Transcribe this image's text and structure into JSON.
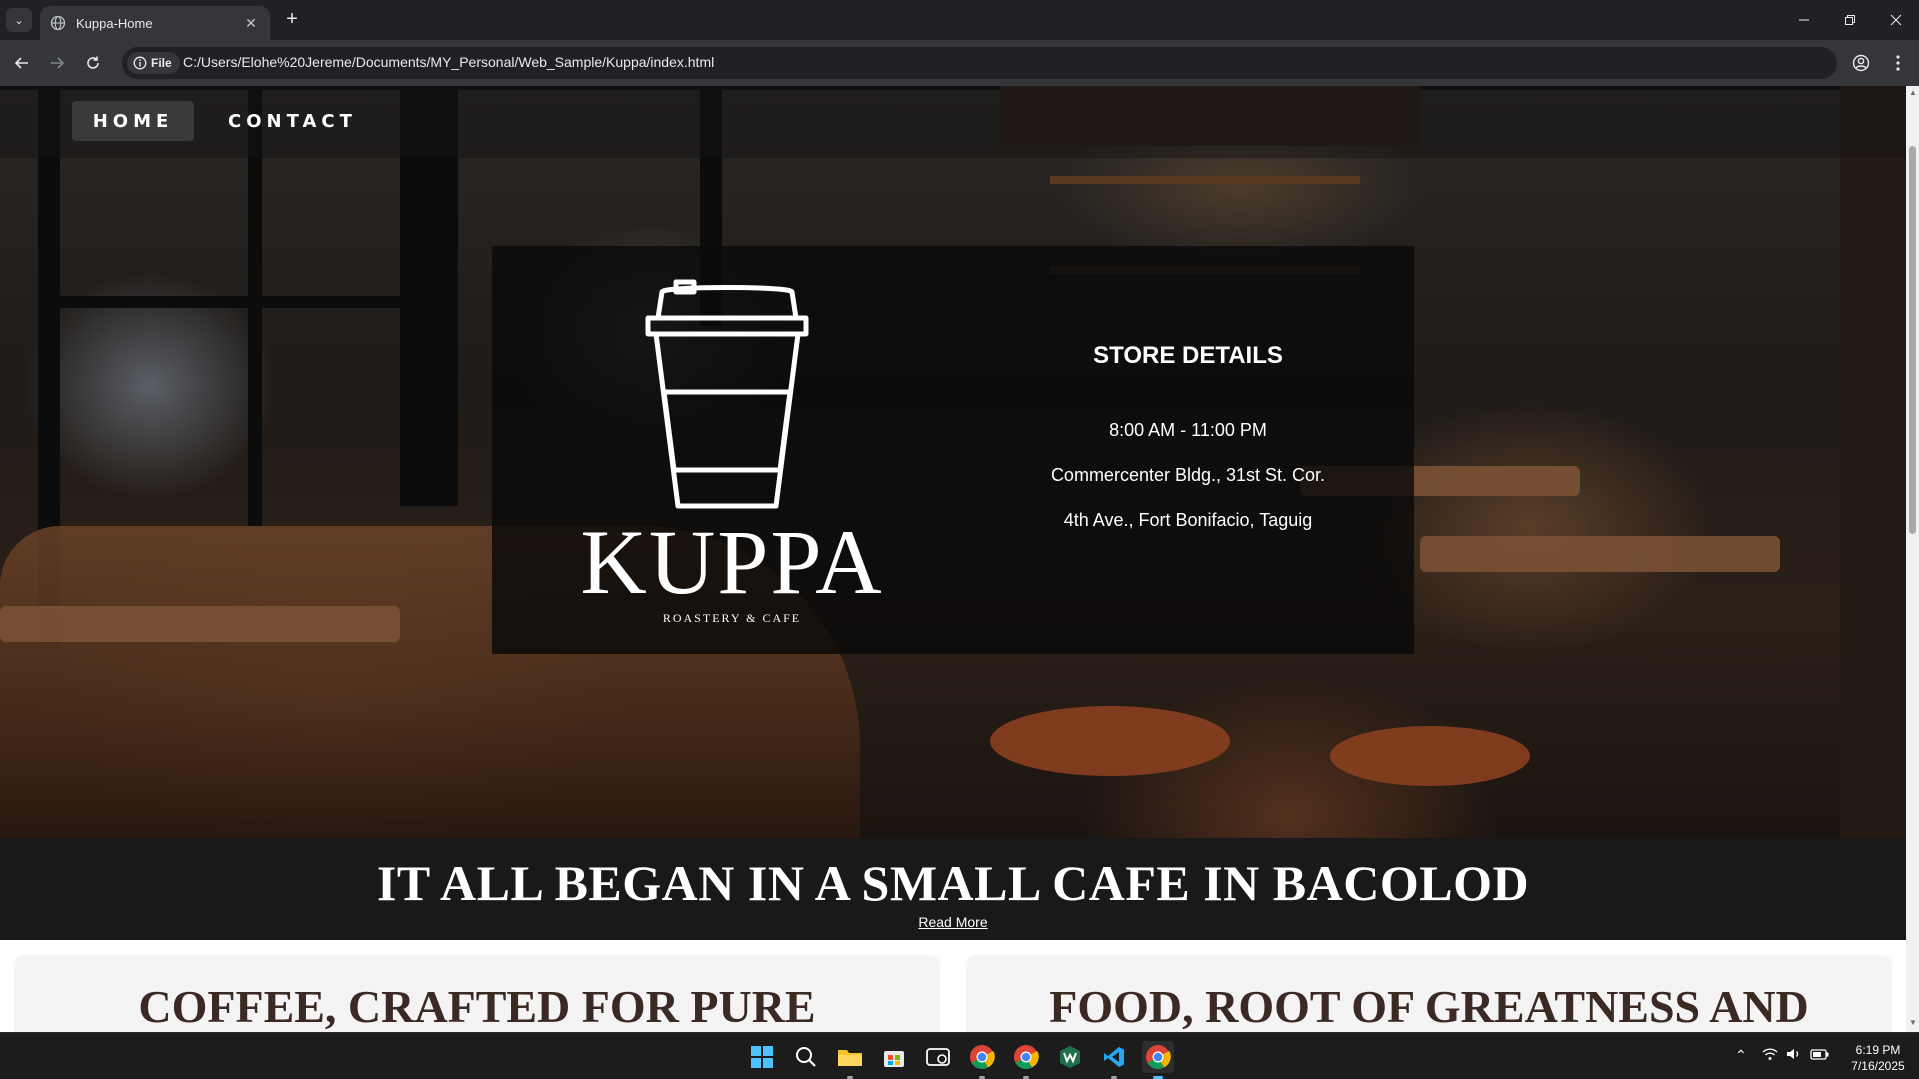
{
  "browser": {
    "tab_title": "Kuppa-Home",
    "tab_close": "✕",
    "new_tab": "+",
    "site_chip": "File",
    "url": "C:/Users/Elohe%20Jereme/Documents/MY_Personal/Web_Sample/Kuppa/index.html"
  },
  "nav": {
    "home": "HOME",
    "contact": "CONTACT"
  },
  "hero": {
    "brand": "KUPPA",
    "tagline": "ROASTERY & CAFE",
    "details_title": "STORE DETAILS",
    "hours": "8:00 AM - 11:00 PM",
    "address_line1": "Commercenter Bldg., 31st St. Cor.",
    "address_line2": "4th Ave., Fort Bonifacio, Taguig"
  },
  "banner": {
    "heading": "IT ALL BEGAN IN A SMALL CAFE IN BACOLOD",
    "read_more": "Read More"
  },
  "panels": [
    {
      "heading": "COFFEE, CRAFTED FOR PURE"
    },
    {
      "heading": "FOOD, ROOT OF GREATNESS AND"
    }
  ],
  "taskbar": {
    "time": "6:19 PM",
    "date": "7/16/2025"
  },
  "colors": {
    "chrome_bg": "#202124",
    "toolbar_bg": "#35363a",
    "banner_bg": "#191919",
    "panel_heading": "#3b2a24",
    "taskbar_bg": "#1c1c1c"
  }
}
